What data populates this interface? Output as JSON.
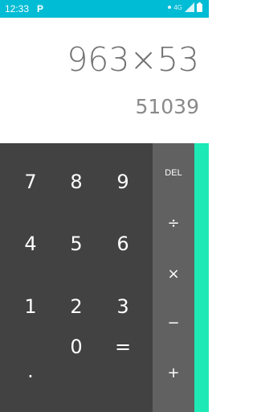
{
  "status_bar": {
    "time": "12:33",
    "app_icon": "P",
    "network": "4G",
    "bg_color": "#00bcd4"
  },
  "display": {
    "expression": "963×53",
    "result": "51039"
  },
  "keypad": {
    "rows": [
      [
        "7",
        "8",
        "9"
      ],
      [
        "4",
        "5",
        "6"
      ],
      [
        "1",
        "2",
        "3"
      ],
      [
        ".",
        "0",
        "="
      ]
    ],
    "bg_color": "#424242"
  },
  "operators": {
    "del": "DEL",
    "divide": "÷",
    "multiply": "×",
    "minus": "−",
    "plus": "+",
    "bg_color": "#616161"
  },
  "advanced_panel": {
    "color": "#1de9b6"
  }
}
